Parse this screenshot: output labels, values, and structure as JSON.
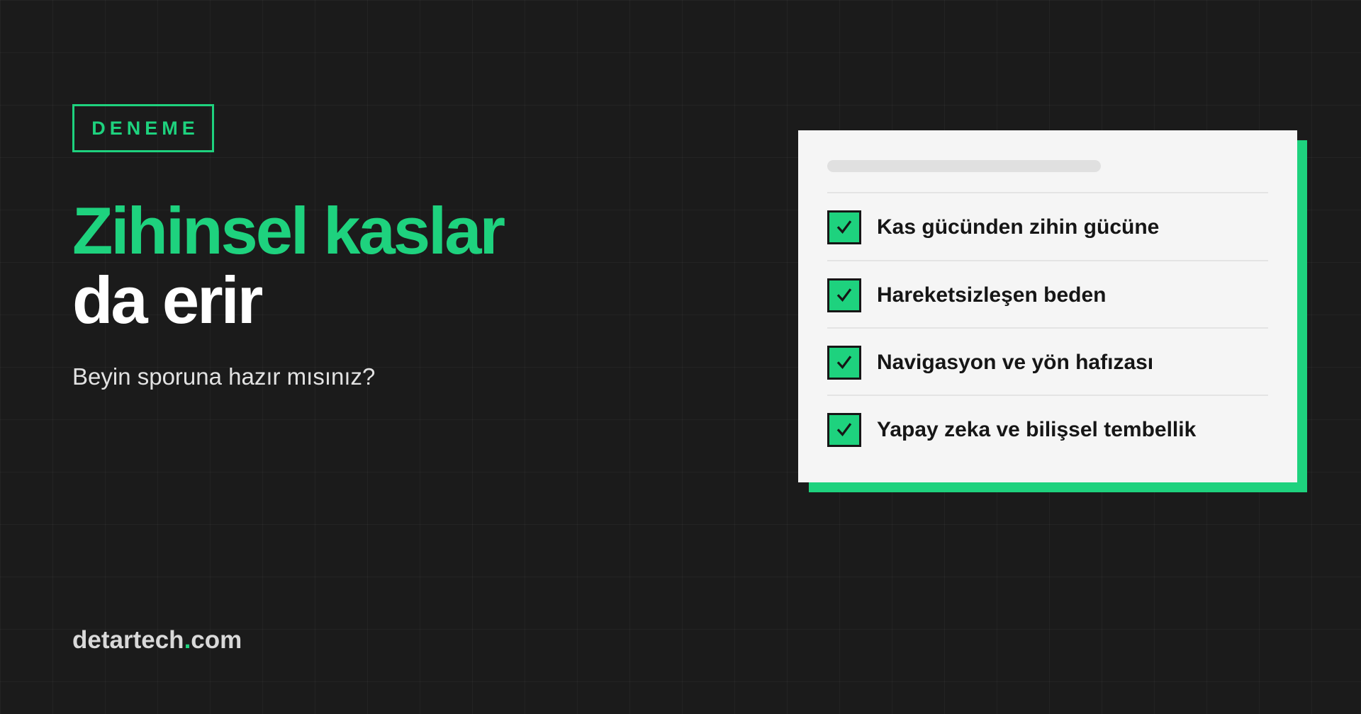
{
  "tag": {
    "label": "DENEME"
  },
  "headline": {
    "line1": "Zihinsel kaslar",
    "line2": "da erir"
  },
  "subtitle": "Beyin sporuna hazır mısınız?",
  "brand": {
    "name": "detartech",
    "dot": ".",
    "tld": "com"
  },
  "card": {
    "items": [
      {
        "label": "Kas gücünden zihin gücüne",
        "checked": true
      },
      {
        "label": "Hareketsizleşen beden",
        "checked": true
      },
      {
        "label": "Navigasyon ve yön hafızası",
        "checked": true
      },
      {
        "label": "Yapay zeka ve bilişsel tembellik",
        "checked": true
      }
    ]
  },
  "icons": {
    "check": "checkmark-icon"
  },
  "colors": {
    "accent": "#1ed27e",
    "background": "#1b1b1b",
    "card": "#f5f5f5",
    "text_dark": "#161616",
    "text_light": "#ffffff"
  }
}
